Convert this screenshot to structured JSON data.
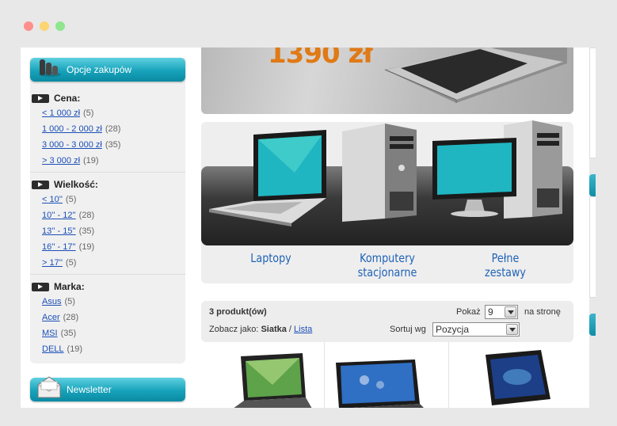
{
  "window": {
    "dot_colors": [
      "#fe8f8c",
      "#fcd572",
      "#8ee68f"
    ]
  },
  "sidebar": {
    "options_title": "Opcje zakupów",
    "groups": [
      {
        "title": "Cena:",
        "items": [
          {
            "label": "< 1 000 zł",
            "count": "(5)"
          },
          {
            "label": "1 000 - 2 000 zł",
            "count": "(28)"
          },
          {
            "label": "3 000 - 3 000 zł",
            "count": "(35)"
          },
          {
            "label": "> 3 000 zł",
            "count": "(19)"
          }
        ]
      },
      {
        "title": "Wielkość:",
        "items": [
          {
            "label": "< 10''",
            "count": "(5)"
          },
          {
            "label": "10'' - 12''",
            "count": "(28)"
          },
          {
            "label": "13'' - 15''",
            "count": "(35)"
          },
          {
            "label": "16'' - 17''",
            "count": "(19)"
          },
          {
            "label": "> 17''",
            "count": "(5)"
          }
        ]
      },
      {
        "title": "Marka:",
        "items": [
          {
            "label": "Asus",
            "count": "(5)"
          },
          {
            "label": "Acer",
            "count": "(28)"
          },
          {
            "label": "MSI",
            "count": "(35)"
          },
          {
            "label": "DELL",
            "count": "(19)"
          }
        ]
      }
    ],
    "newsletter_title": "Newsletter"
  },
  "banner": {
    "price": "1390 zł"
  },
  "categories": [
    {
      "line1": "Laptopy",
      "line2": ""
    },
    {
      "line1": "Komputery",
      "line2": "stacjonarne"
    },
    {
      "line1": "Pełne",
      "line2": "zestawy"
    }
  ],
  "toolbar": {
    "product_count": "3 produkt(ów)",
    "show_label": "Pokaż",
    "show_value": "9",
    "per_page": "na stronę",
    "view_label": "Zobacz jako:",
    "view_grid": "Siatka",
    "view_sep": "/",
    "view_list": "Lista",
    "sort_label": "Sortuj wg",
    "sort_value": "Pozycja"
  },
  "colors": {
    "accent": "#17a3bb",
    "link": "#1b4fb7",
    "price": "#e07a16",
    "category_label": "#1e63b6"
  }
}
